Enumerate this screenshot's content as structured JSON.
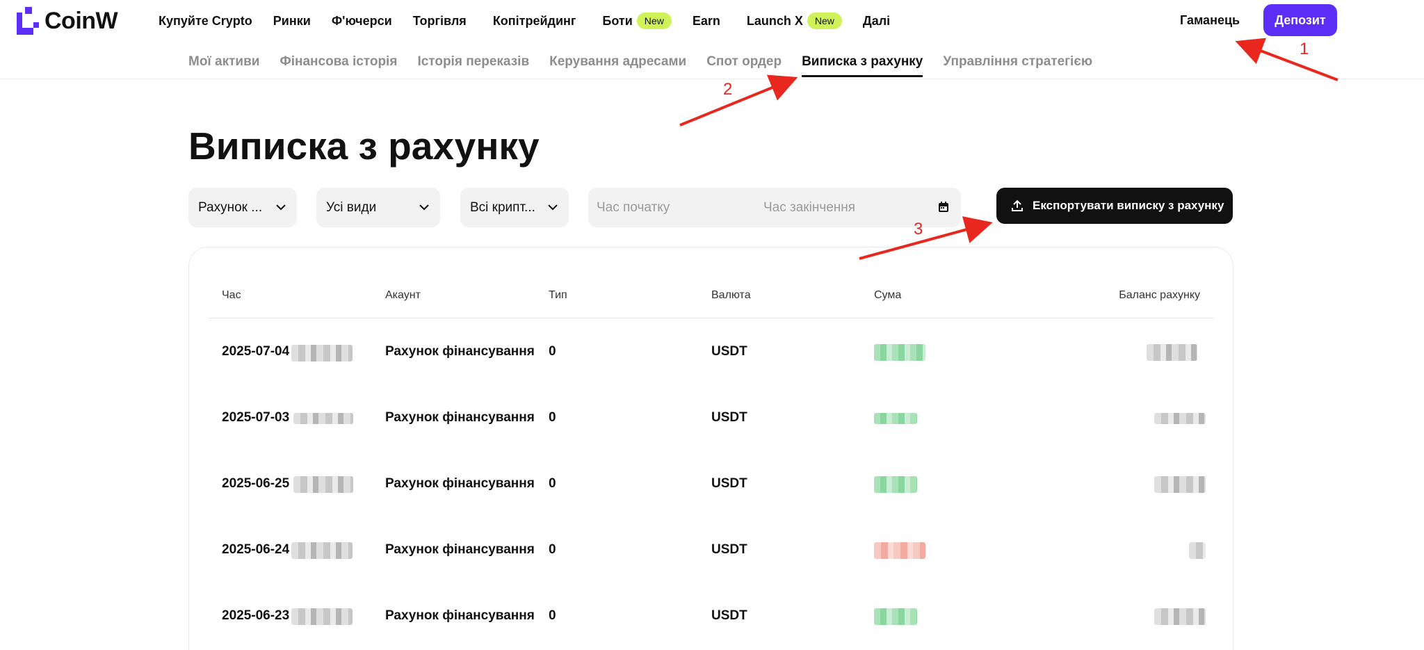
{
  "brand": {
    "name": "CoinW",
    "accent": "#5b2df5"
  },
  "nav": {
    "items": [
      {
        "label": "Купуйте Crypto"
      },
      {
        "label": "Ринки"
      },
      {
        "label": "Ф'ючерси"
      },
      {
        "label": "Торгівля"
      },
      {
        "label": "Копітрейдинг"
      },
      {
        "label": "Боти",
        "badge": "New"
      },
      {
        "label": "Earn"
      },
      {
        "label": "Launch X",
        "badge": "New"
      },
      {
        "label": "Далі"
      }
    ],
    "wallet": "Гаманець",
    "deposit": "Депозит"
  },
  "subnav": {
    "items": [
      {
        "label": "Мої активи"
      },
      {
        "label": "Фінансова історія"
      },
      {
        "label": "Історія переказів"
      },
      {
        "label": "Керування адресами"
      },
      {
        "label": "Спот ордер"
      },
      {
        "label": "Виписка з рахунку",
        "active": true
      },
      {
        "label": "Управління стратегією"
      }
    ]
  },
  "page": {
    "title": "Виписка з рахунку"
  },
  "filters": {
    "account": "Рахунок ...",
    "type": "Усі види",
    "crypto": "Всі крипт...",
    "start_placeholder": "Час початку",
    "end_placeholder": "Час закінчення",
    "export": "Експортувати виписку з рахунку"
  },
  "table": {
    "headers": [
      "Час",
      "Акаунт",
      "Тип",
      "Валюта",
      "Сума",
      "Баланс рахунку"
    ],
    "rows": [
      {
        "date": "2025-07-04",
        "account": "Рахунок фінансування",
        "type": "0",
        "currency": "USDT",
        "amount_sign": "positive"
      },
      {
        "date": "2025-07-03",
        "account": "Рахунок фінансування",
        "type": "0",
        "currency": "USDT",
        "amount_sign": "positive"
      },
      {
        "date": "2025-06-25",
        "account": "Рахунок фінансування",
        "type": "0",
        "currency": "USDT",
        "amount_sign": "positive"
      },
      {
        "date": "2025-06-24",
        "account": "Рахунок фінансування",
        "type": "0",
        "currency": "USDT",
        "amount_sign": "negative"
      },
      {
        "date": "2025-06-23",
        "account": "Рахунок фінансування",
        "type": "0",
        "currency": "USDT",
        "amount_sign": "positive"
      }
    ]
  },
  "annotations": {
    "one": "1",
    "two": "2",
    "three": "3",
    "color": "#e8281e"
  }
}
